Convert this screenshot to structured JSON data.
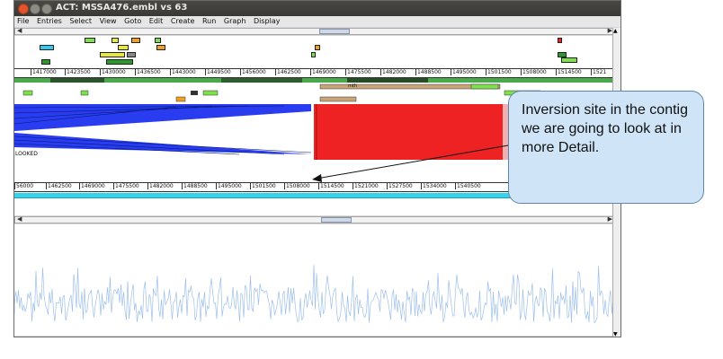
{
  "window": {
    "title": "ACT: MSSA476.embl vs 63"
  },
  "menu": [
    "File",
    "Entries",
    "Select",
    "View",
    "Goto",
    "Edit",
    "Create",
    "Run",
    "Graph",
    "Display"
  ],
  "top_ruler": [
    "1417000",
    "1423500",
    "1430000",
    "1436500",
    "1443000",
    "1449500",
    "1456000",
    "1462500",
    "1469000",
    "1475500",
    "1482000",
    "1488500",
    "1495000",
    "1501500",
    "1508000",
    "1514500",
    "1521"
  ],
  "bottom_ruler": [
    "56000",
    "1462500",
    "1469000",
    "1475500",
    "1482000",
    "1488500",
    "1495000",
    "1501500",
    "1508000",
    "1514500",
    "1521000",
    "1527500",
    "1534000",
    "1540500"
  ],
  "labels": {
    "looked": "LOOKED",
    "mth": "mth"
  },
  "callout": {
    "text": "Inversion site in the contig we are going to look at in more Detail."
  },
  "colors": {
    "match_red": "#ee2222",
    "match_blue": "#2a3cf0",
    "callout_bg": "#cfe5f7",
    "cyan_bar": "#34d4ee"
  }
}
